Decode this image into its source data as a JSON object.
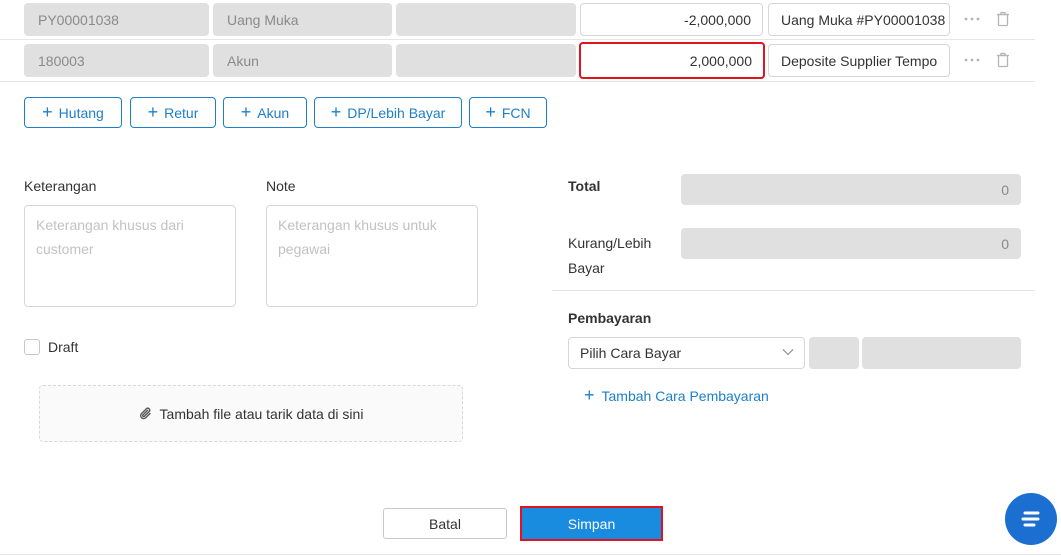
{
  "rows": [
    {
      "code": "PY00001038",
      "name": "Uang Muka",
      "amount": "-2,000,000",
      "reference": "Uang Muka #PY00001038"
    },
    {
      "code": "180003",
      "name": "Akun",
      "amount": "2,000,000",
      "reference": "Deposite Supplier Tempo"
    }
  ],
  "add_buttons": [
    "Hutang",
    "Retur",
    "Akun",
    "DP/Lebih Bayar",
    "FCN"
  ],
  "keterangan": {
    "label": "Keterangan",
    "placeholder": "Keterangan khusus dari customer"
  },
  "note": {
    "label": "Note",
    "placeholder": "Keterangan khusus untuk pegawai"
  },
  "draft_label": "Draft",
  "upload_label": "Tambah file atau tarik data di sini",
  "summary": {
    "total_label": "Total",
    "total_value": "0",
    "kurang_label_1": "Kurang/Lebih",
    "kurang_label_2": "Bayar",
    "kurang_value": "0"
  },
  "pembayaran": {
    "title": "Pembayaran",
    "select_value": "Pilih Cara Bayar",
    "add_label": "Tambah Cara Pembayaran"
  },
  "footer": {
    "cancel_label": "Batal",
    "save_label": "Simpan"
  },
  "colors": {
    "accent": "#1d7fc9",
    "primary_button": "#1a8ce0",
    "highlight": "#e0141e",
    "readonly_bg": "#e0e0e0"
  },
  "icons": [
    "more-horizontal-icon",
    "trash-icon",
    "plus-icon",
    "paperclip-icon",
    "chevron-down-icon",
    "chat-icon"
  ]
}
